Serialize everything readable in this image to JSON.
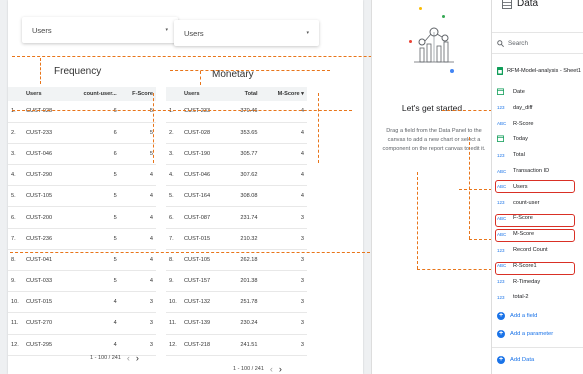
{
  "controls": [
    {
      "label": "Users",
      "arrow": "▾"
    },
    {
      "label": "Users",
      "arrow": "▾"
    }
  ],
  "frequency": {
    "title": "Frequency",
    "headers": [
      "Users",
      "count-user...",
      "F-Score"
    ],
    "rows": [
      [
        "1.",
        "CUST-028",
        "6",
        "5"
      ],
      [
        "2.",
        "CUST-233",
        "6",
        "5"
      ],
      [
        "3.",
        "CUST-046",
        "6",
        "5"
      ],
      [
        "4.",
        "CUST-290",
        "5",
        "4"
      ],
      [
        "5.",
        "CUST-105",
        "5",
        "4"
      ],
      [
        "6.",
        "CUST-200",
        "5",
        "4"
      ],
      [
        "7.",
        "CUST-236",
        "5",
        "4"
      ],
      [
        "8.",
        "CUST-041",
        "5",
        "4"
      ],
      [
        "9.",
        "CUST-033",
        "5",
        "4"
      ],
      [
        "10.",
        "CUST-015",
        "4",
        "3"
      ],
      [
        "11.",
        "CUST-270",
        "4",
        "3"
      ],
      [
        "12.",
        "CUST-295",
        "4",
        "3"
      ]
    ],
    "pager": "1 - 100 / 241"
  },
  "monetary": {
    "title": "Monetary",
    "headers": [
      "Users",
      "Total",
      "M-Score ▾"
    ],
    "rows": [
      [
        "1.",
        "CUST-233",
        "370.46",
        "4"
      ],
      [
        "2.",
        "CUST-028",
        "353.65",
        "4"
      ],
      [
        "3.",
        "CUST-190",
        "305.77",
        "4"
      ],
      [
        "4.",
        "CUST-046",
        "307.62",
        "4"
      ],
      [
        "5.",
        "CUST-164",
        "308.08",
        "4"
      ],
      [
        "6.",
        "CUST-087",
        "231.74",
        "3"
      ],
      [
        "7.",
        "CUST-015",
        "210.32",
        "3"
      ],
      [
        "8.",
        "CUST-105",
        "262.18",
        "3"
      ],
      [
        "9.",
        "CUST-157",
        "201.38",
        "3"
      ],
      [
        "10.",
        "CUST-132",
        "251.78",
        "3"
      ],
      [
        "11.",
        "CUST-139",
        "230.24",
        "3"
      ],
      [
        "12.",
        "CUST-218",
        "241.51",
        "3"
      ]
    ],
    "pager": "1 - 100 / 241"
  },
  "pager_prev": "‹",
  "pager_next": "›",
  "empty_state": {
    "title": "Let's get started",
    "description": "Drag a field from the Data Panel to the canvas to add a new chart or select a component on the report canvas to edit it."
  },
  "data_panel": {
    "title": "Data",
    "search_placeholder": "Search",
    "source": "RFM-Model-analysis - Sheet1",
    "fields": [
      {
        "type": "date",
        "label": "Date"
      },
      {
        "type": "123",
        "label": "day_diff"
      },
      {
        "type": "ABC",
        "label": "R-Score"
      },
      {
        "type": "date",
        "label": "Today"
      },
      {
        "type": "123",
        "label": "Total"
      },
      {
        "type": "ABC",
        "label": "Transaction ID"
      },
      {
        "type": "ABC",
        "label": "Users"
      },
      {
        "type": "123",
        "label": "count-user"
      },
      {
        "type": "ABC",
        "label": "F-Score"
      },
      {
        "type": "ABC",
        "label": "M-Score"
      },
      {
        "type": "123",
        "label": "Record Count"
      },
      {
        "type": "ABC",
        "label": "R-Score1"
      },
      {
        "type": "123",
        "label": "R-Timeday"
      },
      {
        "type": "123",
        "label": "total-2"
      }
    ],
    "add_field": "Add a field",
    "add_parameter": "Add a parameter",
    "add_data": "Add Data"
  },
  "colors": {
    "accent": "#1a73e8",
    "highlight": "#d93025",
    "dashed": "#e8751a",
    "source_icon": "#0f9d58"
  }
}
